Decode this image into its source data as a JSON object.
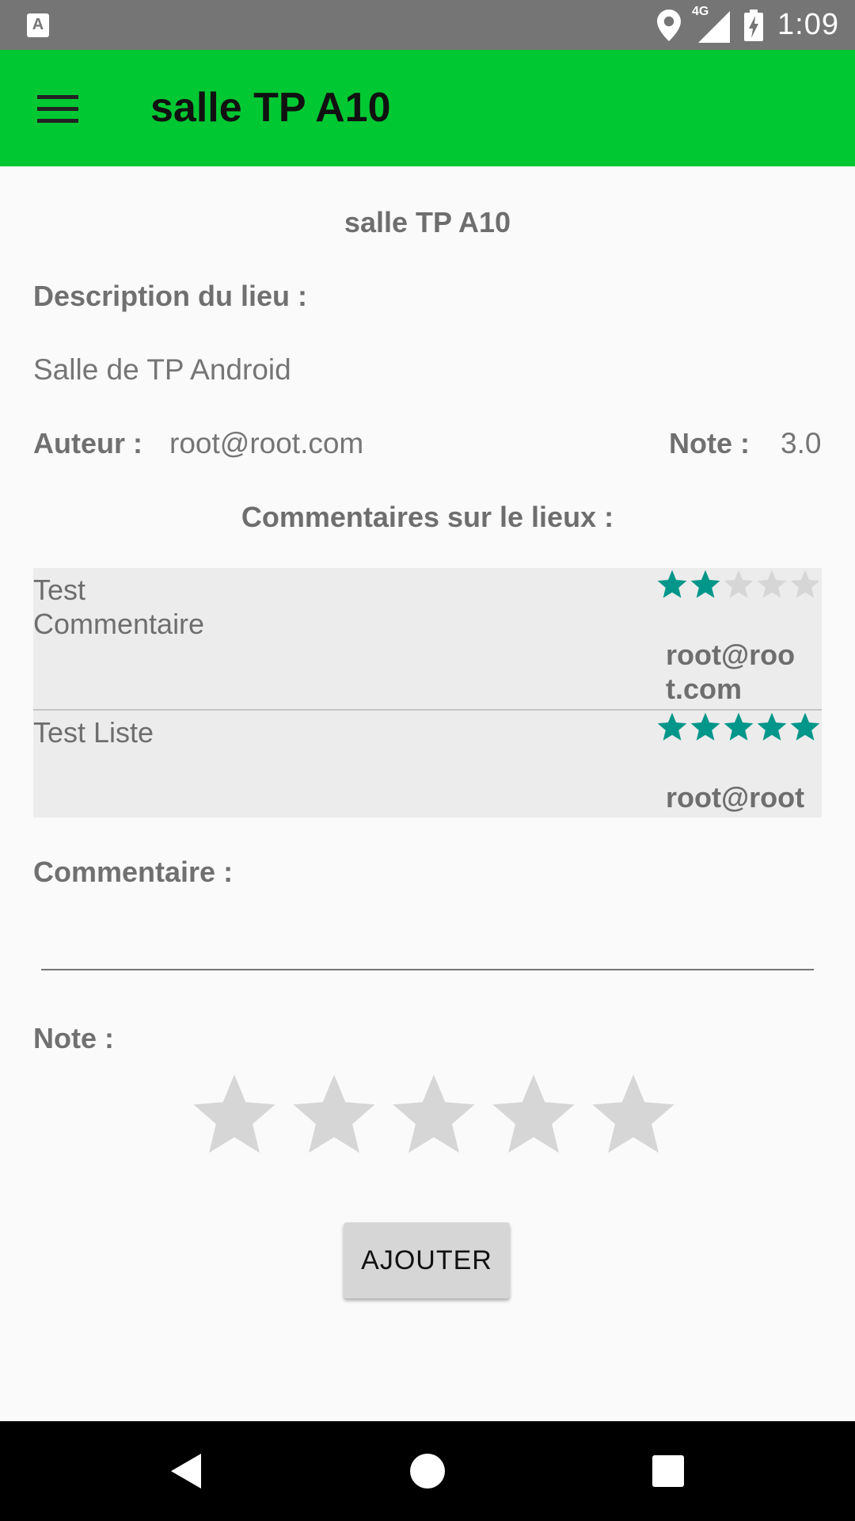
{
  "status_bar": {
    "app_icon_letter": "A",
    "network": "4G",
    "time": "1:09"
  },
  "app_bar": {
    "title": "salle TP A10",
    "menu_icon": "hamburger-menu-icon"
  },
  "place": {
    "title": "salle TP A10",
    "description_label": "Description du lieu :",
    "description": "Salle de TP Android",
    "author_label": "Auteur :",
    "author": "root@root.com",
    "note_label": "Note :",
    "note": "3.0"
  },
  "comments": {
    "heading": "Commentaires sur le lieux :",
    "items": [
      {
        "text": "Test Commentaire",
        "rating": 2,
        "max_rating": 5,
        "author": "root@root.com"
      },
      {
        "text": "Test Liste",
        "rating": 5,
        "max_rating": 5,
        "author": "root@root"
      }
    ]
  },
  "form": {
    "comment_label": "Comment aire :",
    "comment_value": "",
    "rating_label": "Note :",
    "rating": 0,
    "max_rating": 5,
    "submit_label": "AJOUTER"
  },
  "colors": {
    "app_bar": "#00c832",
    "star_filled": "#00968a",
    "star_empty": "#d6d6d6",
    "status_bar": "#757575"
  },
  "nav_bar": {
    "icons": [
      "back-icon",
      "home-icon",
      "recents-icon"
    ]
  }
}
